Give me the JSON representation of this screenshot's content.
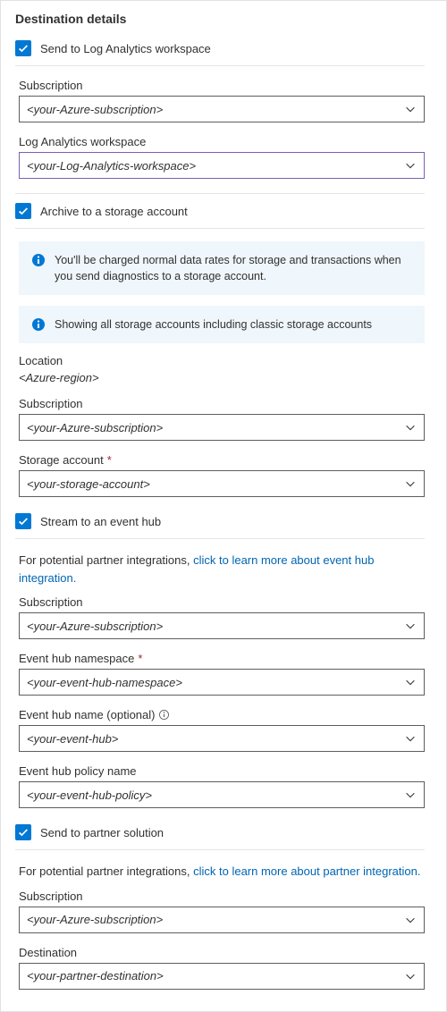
{
  "title": "Destination details",
  "logAnalytics": {
    "checkbox_label": "Send to Log Analytics workspace",
    "subscription_label": "Subscription",
    "subscription_value": "<your-Azure-subscription>",
    "workspace_label": "Log Analytics workspace",
    "workspace_value": "<your-Log-Analytics-workspace>"
  },
  "storage": {
    "checkbox_label": "Archive to a storage account",
    "info1": "You'll be charged normal data rates for storage and transactions when you send diagnostics to a storage account.",
    "info2": "Showing all storage accounts including classic storage accounts",
    "location_label": "Location",
    "location_value": "<Azure-region>",
    "subscription_label": "Subscription",
    "subscription_value": "<your-Azure-subscription>",
    "account_label": "Storage account",
    "account_value": "<your-storage-account>"
  },
  "eventHub": {
    "checkbox_label": "Stream to an event hub",
    "intro_prefix": "For potential partner integrations, ",
    "intro_link": "click to learn more about event hub integration.",
    "subscription_label": "Subscription",
    "subscription_value": "<your-Azure-subscription>",
    "namespace_label": "Event hub namespace",
    "namespace_value": "<your-event-hub-namespace>",
    "name_label": "Event hub name (optional)",
    "name_value": "<your-event-hub>",
    "policy_label": "Event hub policy name",
    "policy_value": "<your-event-hub-policy>"
  },
  "partner": {
    "checkbox_label": "Send to partner solution",
    "intro_prefix": "For potential partner integrations, ",
    "intro_link": "click to learn more about partner integration.",
    "subscription_label": "Subscription",
    "subscription_value": "<your-Azure-subscription>",
    "destination_label": "Destination",
    "destination_value": "<your-partner-destination>"
  }
}
